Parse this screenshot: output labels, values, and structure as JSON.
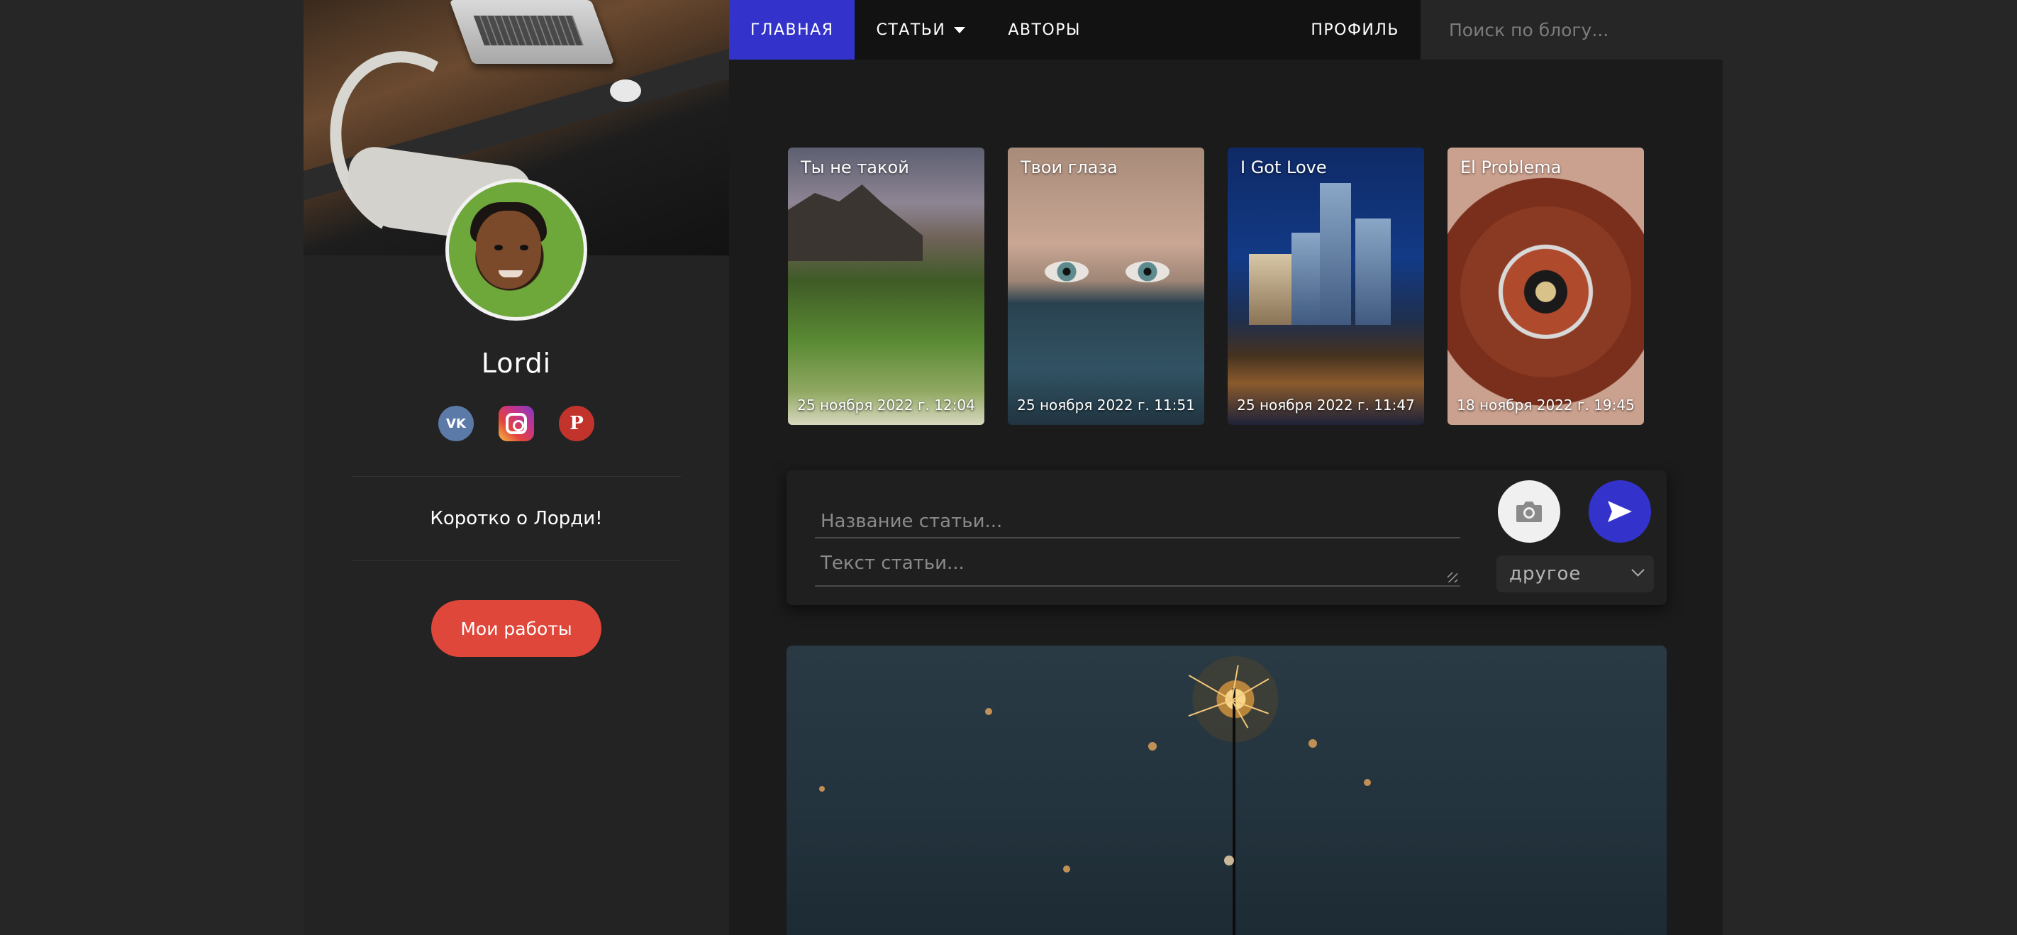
{
  "nav": {
    "items": [
      {
        "label": "ГЛАВНАЯ"
      },
      {
        "label": "СТАТЬИ"
      },
      {
        "label": "АВТОРЫ"
      }
    ],
    "profile_label": "ПРОФИЛЬ",
    "search_placeholder": "Поиск по блогу..."
  },
  "sidebar": {
    "username": "Lordi",
    "socials": [
      {
        "name": "vk-icon",
        "glyph": "VK",
        "color": "#5b7aa8"
      },
      {
        "name": "instagram-icon",
        "color": "#e2453c"
      },
      {
        "name": "pinterest-icon",
        "glyph": "P",
        "color": "#c2332c"
      }
    ],
    "about": "Коротко о Лорди!",
    "works_button": "Мои работы"
  },
  "cards": [
    {
      "title": "Ты не такой",
      "date": "25 ноября 2022 г. 12:04"
    },
    {
      "title": "Твои глаза",
      "date": "25 ноября 2022 г. 11:51"
    },
    {
      "title": "I Got Love",
      "date": "25 ноября 2022 г. 11:47"
    },
    {
      "title": "El Problema",
      "date": "18 ноября 2022 г. 19:45"
    }
  ],
  "composer": {
    "title_placeholder": "Название статьи...",
    "text_placeholder": "Текст статьи...",
    "category": "другое"
  },
  "colors": {
    "accent": "#3333cc",
    "button_red": "#e0473b",
    "background": "#262626",
    "panel": "#1b1b1b"
  }
}
